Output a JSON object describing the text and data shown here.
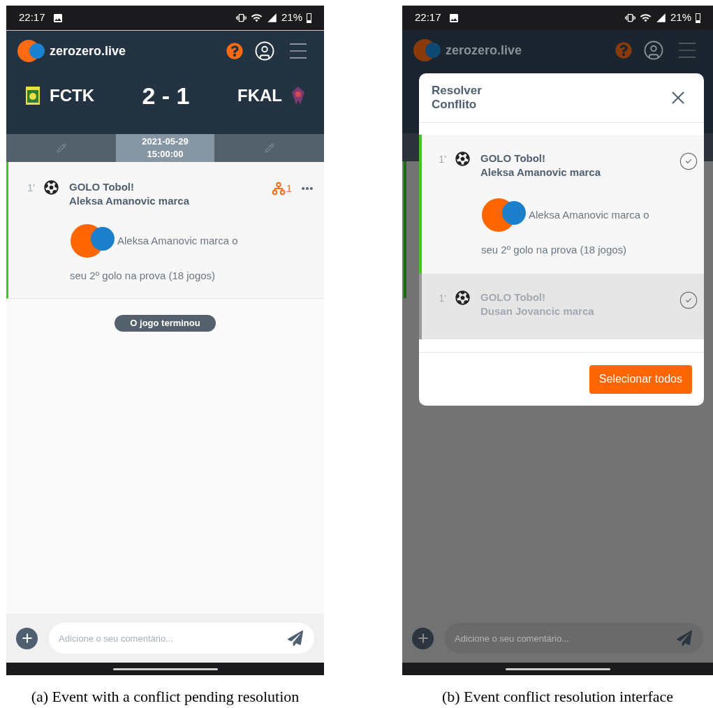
{
  "event_view": {
    "status_bar": {
      "time": "22:17",
      "battery": "21%"
    },
    "header": {
      "brand": "zerozero.live"
    },
    "match": {
      "home_team": "FCTK",
      "score": "2 - 1",
      "away_team": "FKAL"
    },
    "kickoff": {
      "date": "2021-05-29",
      "time": "15:00:00"
    },
    "event": {
      "minute": "1'",
      "title": "GOLO Tobol!",
      "player_line": "Aleksa Amanovic marca",
      "comment_lines": [
        "Aleksa Amanovic marca o",
        "seu 2º golo na prova (18 jogos)"
      ],
      "conflict_count": "1"
    },
    "status_pill": "O jogo terminou",
    "comment_field": {
      "placeholder": "Adicione o seu comentário..."
    },
    "caption": "(a) Event with a conflict pending resolution"
  },
  "conflict_view": {
    "status_bar": {
      "time": "22:17",
      "battery": "21%"
    },
    "header": {
      "brand": "zerozero.live"
    },
    "dialog": {
      "title": "Resolver Conflito",
      "options": [
        {
          "minute": "1'",
          "title": "GOLO Tobol!",
          "player_line": "Aleksa Amanovic marca",
          "comment_lines": [
            "Aleksa Amanovic marca o",
            "seu 2º golo na prova (18 jogos)"
          ],
          "selected": true
        },
        {
          "minute": "1'",
          "title": "GOLO Tobol!",
          "player_line": "Dusan Jovancic marca",
          "selected": false
        }
      ],
      "button": "Selecionar todos"
    },
    "comment_field": {
      "placeholder": "Adicione o seu comentário..."
    },
    "caption": "(b) Event conflict resolution interface"
  }
}
